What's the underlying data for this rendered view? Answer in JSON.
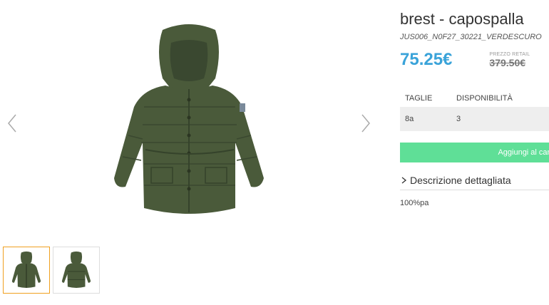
{
  "product": {
    "title": "brest - capospalla",
    "sku": "JUS006_N0F27_30221_VERDESCURO",
    "price": "75.25€",
    "retail_label": "PREZZO RETAIL",
    "retail_price": "379.50€"
  },
  "sizes": {
    "header_size": "TAGLIE",
    "header_availability": "DISPONIBILITÀ",
    "rows": [
      {
        "size": "8a",
        "availability": "3"
      }
    ]
  },
  "actions": {
    "add_to_cart": "Aggiungi al carrello"
  },
  "description": {
    "toggle_label": "Descrizione dettagliata",
    "text": "100%pa"
  },
  "gallery": {
    "prev_icon": "chevron-left-icon",
    "next_icon": "chevron-right-icon",
    "thumbnail_count": 2,
    "active_thumbnail": 1
  },
  "colors": {
    "price": "#3aa3d9",
    "button": "#5fdf97",
    "jacket": "#4a5a3a",
    "active_thumb_border": "#f0a020"
  }
}
